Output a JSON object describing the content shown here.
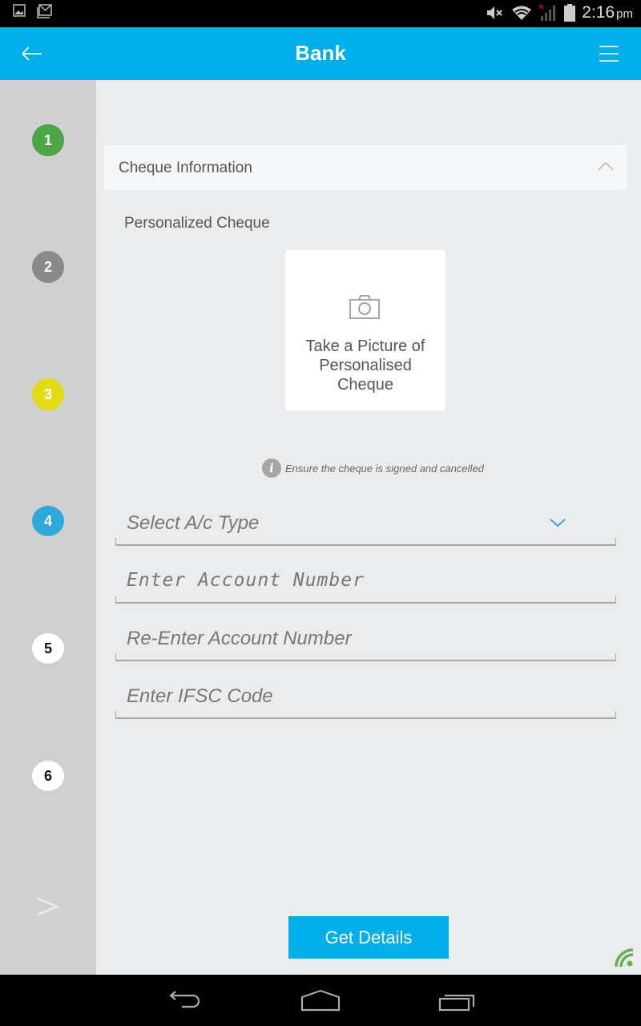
{
  "status_bar": {
    "left_icons": [
      "gallery-icon",
      "gmail-icon"
    ],
    "right_icons": [
      "mute-icon",
      "wifi-icon",
      "no-signal-icon",
      "battery-icon"
    ],
    "time": "2:16",
    "ampm": "pm"
  },
  "app_bar": {
    "title": "Bank",
    "back_icon": "arrow-left-icon",
    "menu_icon": "hamburger-menu-icon",
    "color": "#00aeea"
  },
  "sidebar": {
    "steps": [
      {
        "label": "1",
        "state": "completed",
        "color": "#4ca646"
      },
      {
        "label": "2",
        "state": "inactive",
        "color": "#8a8a8a"
      },
      {
        "label": "3",
        "state": "pending",
        "color": "#e3dc14"
      },
      {
        "label": "4",
        "state": "current",
        "color": "#2da9dc"
      },
      {
        "label": "5",
        "state": "todo",
        "color": "#ffffff"
      },
      {
        "label": "6",
        "state": "todo",
        "color": "#ffffff"
      }
    ],
    "next_icon": "chevron-right-icon"
  },
  "main": {
    "section": {
      "title": "Cheque Information",
      "expanded": true
    },
    "subsection_label": "Personalized Cheque",
    "photo_card": {
      "icon": "camera-icon",
      "text": "Take a Picture of Personalised Cheque"
    },
    "hint": {
      "icon": "info-icon",
      "text": "Ensure the cheque is signed and cancelled"
    },
    "fields": {
      "account_type": {
        "placeholder": "Select A/c Type",
        "value": ""
      },
      "account_number": {
        "placeholder": "Enter Account Number",
        "value": ""
      },
      "reenter_account_number": {
        "placeholder": "Re-Enter Account Number",
        "value": ""
      },
      "ifsc_code": {
        "placeholder": "Enter IFSC Code",
        "value": ""
      }
    },
    "submit_label": "Get Details",
    "connectivity_icon": "wifi-signal-icon",
    "connectivity_color": "#6ab04c"
  },
  "nav_bar": {
    "back": "back-icon",
    "home": "home-icon",
    "recents": "recents-icon"
  }
}
